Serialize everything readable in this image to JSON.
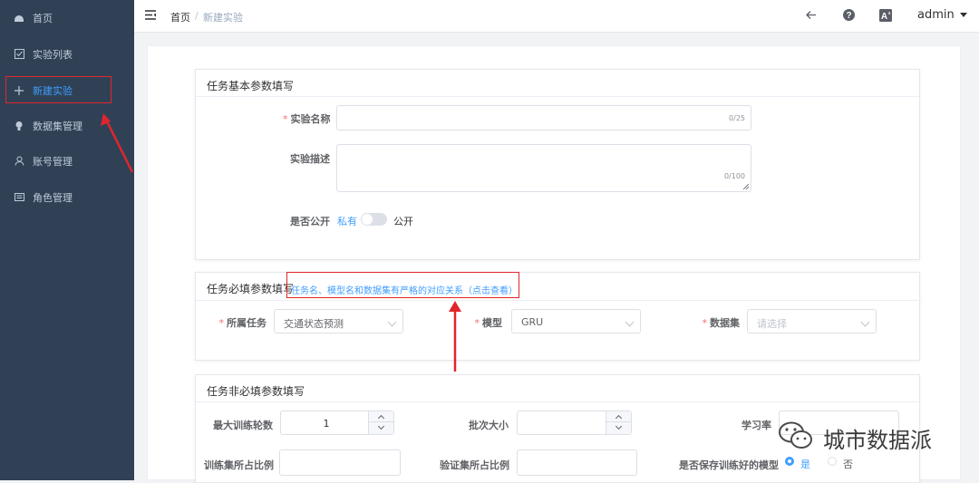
{
  "sidebar": {
    "items": [
      {
        "label": "首页",
        "icon": "dashboard-icon"
      },
      {
        "label": "实验列表",
        "icon": "checkbox-icon"
      },
      {
        "label": "新建实验",
        "icon": "plus-icon"
      },
      {
        "label": "数据集管理",
        "icon": "bulb-icon"
      },
      {
        "label": "账号管理",
        "icon": "user-icon"
      },
      {
        "label": "角色管理",
        "icon": "list-icon"
      }
    ]
  },
  "header": {
    "breadcrumb_home": "首页",
    "breadcrumb_sep": "/",
    "breadcrumb_current": "新建实验",
    "user": "admin"
  },
  "basic": {
    "title": "任务基本参数填写",
    "name_label": "实验名称",
    "name_count": "0/25",
    "desc_label": "实验描述",
    "desc_count": "0/100",
    "public_label": "是否公开",
    "private_text": "私有",
    "public_text": "公开"
  },
  "required": {
    "title": "任务必填参数填写",
    "link": "任务名、模型名和数据集有严格的对应关系（点击查看）",
    "task_label": "所属任务",
    "task_value": "交通状态预测",
    "model_label": "模型",
    "model_value": "GRU",
    "dataset_label": "数据集",
    "dataset_placeholder": "请选择"
  },
  "optional": {
    "title": "任务非必填参数填写",
    "epochs_label": "最大训练轮数",
    "epochs_value": "1",
    "batch_label": "批次大小",
    "lr_label": "学习率",
    "train_label": "训练集所占比例",
    "valid_label": "验证集所占比例",
    "save_label": "是否保存训练好的模型",
    "save_yes": "是",
    "save_no": "否"
  },
  "watermark": "城市数据派",
  "colors": {
    "sidebar": "#304156",
    "accent": "#409eff",
    "annotation": "#e0262c"
  }
}
